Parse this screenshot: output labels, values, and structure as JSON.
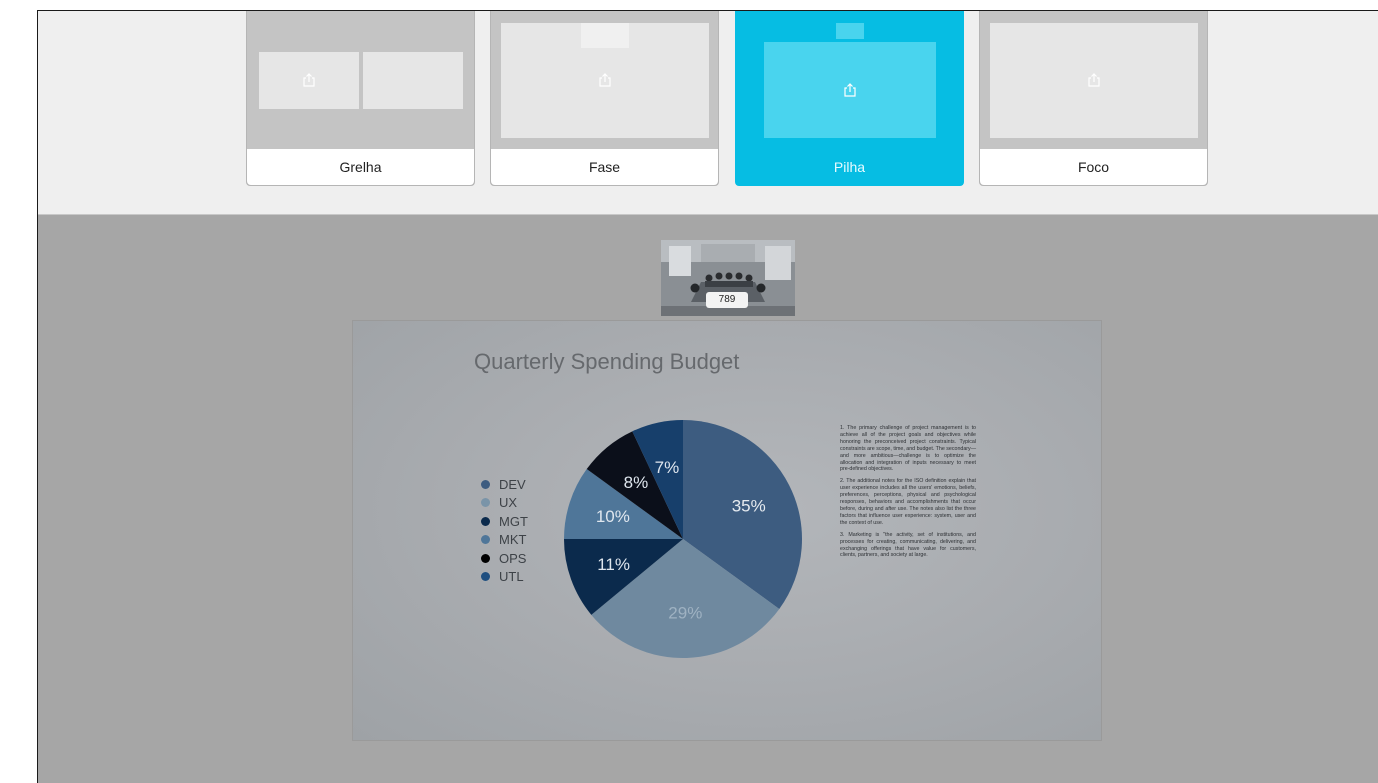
{
  "layouts": [
    {
      "label": "Grelha",
      "selected": false
    },
    {
      "label": "Fase",
      "selected": false
    },
    {
      "label": "Pilha",
      "selected": true
    },
    {
      "label": "Foco",
      "selected": false
    }
  ],
  "participant_thumbnail": {
    "badge": "789"
  },
  "slide": {
    "title": "Quarterly Spending Budget",
    "notes": [
      "1. The primary challenge of project management is to achieve all of the project goals and objectives while honoring the preconceived project constraints. Typical constraints are scope, time, and budget. The secondary—and more ambitious—challenge is to optimize the allocation and integration of inputs necessary to meet pre-defined objectives.",
      "2. The additional notes for the ISO definition explain that user experience includes all the users' emotions, beliefs, preferences, perceptions, physical and psychological responses, behaviors and accomplishments that occur before, during and after use. The notes also list the three factors that influence user experience: system, user and the context of use.",
      "3. Marketing is \"the activity, set of institutions, and processes for creating, communicating, delivering, and exchanging offerings that have value for customers, clients, partners, and society at large."
    ]
  },
  "chart_data": {
    "type": "pie",
    "title": "Quarterly Spending Budget",
    "legend_position": "left",
    "categories": [
      "DEV",
      "UX",
      "MGT",
      "MKT",
      "OPS",
      "UTL"
    ],
    "values": [
      35,
      29,
      11,
      10,
      8,
      7
    ],
    "labels": [
      "35%",
      "29%",
      "11%",
      "10%",
      "8%",
      "7%"
    ],
    "colors": [
      "#3d5c80",
      "#6f899f",
      "#0b2a4c",
      "#4f7699",
      "#0b0f1a",
      "#173f6b"
    ],
    "legend_colors": [
      "#3d5c80",
      "#7a94a8",
      "#0b2a4c",
      "#4f7699",
      "#000000",
      "#1f4f80"
    ],
    "label_colors": [
      "#e6ebf0",
      "#9fb2c2",
      "#dfe6ee",
      "#dfe6ee",
      "#dfe6ee",
      "#dfe6ee"
    ]
  }
}
